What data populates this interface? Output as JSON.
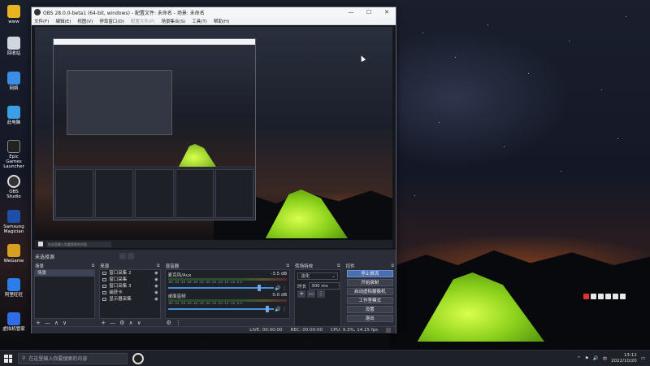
{
  "desktop": {
    "icons": [
      {
        "label": "www",
        "color": "#e8b422"
      },
      {
        "label": "回收站",
        "color": "#cfd6e0"
      },
      {
        "label": "网络",
        "color": "#3a8ee6"
      },
      {
        "label": "此电脑",
        "color": "#3aa0e6"
      },
      {
        "label": "Epic Games Launcher",
        "color": "#222222"
      },
      {
        "label": "OBS Studio",
        "color": "#333333"
      },
      {
        "label": "Samsung Magician",
        "color": "#1d4fa8"
      },
      {
        "label": "WeGame",
        "color": "#d8a020"
      },
      {
        "label": "阿里旺旺",
        "color": "#2b7de9"
      },
      {
        "label": "虚拟机管家",
        "color": "#2f6de8"
      }
    ]
  },
  "obs": {
    "title": "OBS 28.0.0-beta1 (64-bit, windows) - 配置文件: 未命名 - 场景: 未命名",
    "window_controls": {
      "minimize": "—",
      "maximize": "☐",
      "close": "✕"
    },
    "menu": [
      "文件(F)",
      "编辑(E)",
      "视图(V)",
      "停靠窗口(D)",
      "配置文件(P)",
      "场景集合(S)",
      "工具(T)",
      "帮助(H)"
    ],
    "scene_bar_label": "未选择源",
    "preview_taskbar_search": "在这里输入你要搜索的内容",
    "docks": {
      "scenes": {
        "title": "场景",
        "items": [
          "场景"
        ]
      },
      "sources": {
        "title": "来源",
        "items": [
          {
            "name": "窗口采集 2",
            "visible": "◉",
            "lock": "🔒"
          },
          {
            "name": "窗口采集",
            "visible": "◉",
            "lock": "🔒"
          },
          {
            "name": "窗口采集 3",
            "visible": "◉",
            "lock": "🔒"
          },
          {
            "name": "捕获卡",
            "visible": "◉",
            "lock": "🔒"
          },
          {
            "name": "显示器采集",
            "visible": "◉",
            "lock": "🔒"
          }
        ]
      },
      "mixer": {
        "title": "混音器",
        "channels": [
          {
            "name": "麦克风/Aux",
            "db": "-3.5 dB",
            "level": 0.86
          },
          {
            "name": "桌面音频",
            "db": "0.0 dB",
            "level": 0.94
          }
        ],
        "ticks": "-60 -55 -50 -45 -40 -35 -30 -25 -20 -15 -10 -5 0"
      },
      "transitions": {
        "title": "转场特效",
        "selected": "淡化",
        "duration_label": "时长",
        "duration": "300 ms"
      },
      "controls": {
        "title": "控件",
        "buttons": [
          "停止推流",
          "开始录制",
          "启动虚拟摄像机",
          "工作室模式",
          "设置",
          "退出"
        ]
      },
      "float_icon": "⧉",
      "close_icon": "✕"
    },
    "statusbar": {
      "live": "LIVE: 00:00:00",
      "rec": "REC: 00:00:00",
      "cpu": "CPU: 9.3%, 14.15 fps"
    }
  },
  "taskbar": {
    "search_placeholder": "在这里输入你要搜索的内容",
    "time": "13:12",
    "date": "2022/10/20",
    "tray": [
      "^",
      "⚑",
      "🔊",
      "中"
    ]
  }
}
